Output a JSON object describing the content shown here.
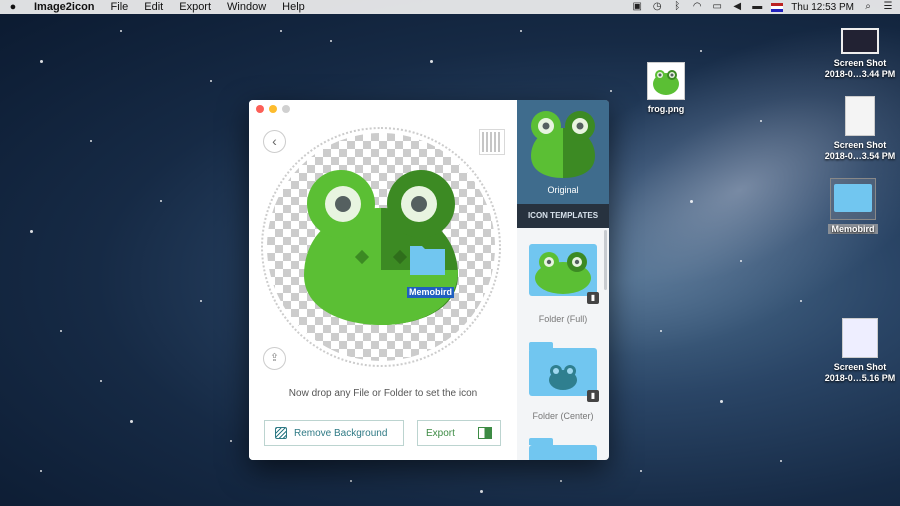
{
  "menubar": {
    "apple_icon": "apple-icon",
    "app_name": "Image2icon",
    "menus": [
      "File",
      "Edit",
      "Export",
      "Window",
      "Help"
    ],
    "clock": "Thu 12:53 PM",
    "status_icons": [
      "notification-icon",
      "time-machine-icon",
      "bluetooth-icon",
      "wifi-icon",
      "airplay-icon",
      "volume-icon",
      "battery-icon",
      "flag-icon",
      "search-icon",
      "list-icon"
    ]
  },
  "desktop": {
    "icons": [
      {
        "label": "Screen Shot\n2018-0…3.44 PM"
      },
      {
        "label": "frog.png"
      },
      {
        "label": "Screen Shot\n2018-0…3.54 PM"
      },
      {
        "label": "Memobird"
      },
      {
        "label": "Screen Shot\n2018-0…5.16 PM"
      }
    ]
  },
  "window": {
    "traffic_lights": [
      "#fc5f57",
      "#fdbc2e",
      "#d0d0d0"
    ],
    "drop_message": "Now drop any File or Folder to set the icon",
    "preview_badge": "Memobird",
    "remove_bg_label": "Remove Background",
    "export_label": "Export",
    "sidebar": {
      "original_label": "Original",
      "templates_header": "ICON TEMPLATES",
      "templates": [
        {
          "label": "Folder (Full)",
          "locked": true
        },
        {
          "label": "Folder (Center)",
          "locked": true
        }
      ]
    }
  },
  "colors": {
    "frog_light": "#5bbf34",
    "frog_dark": "#3c8a23",
    "eye_white": "#e8f4e0",
    "pupil": "#556060",
    "folder_blue": "#71c6f0",
    "sidebar_dark": "#2e3a48",
    "original_bg": "#3f6c8d"
  }
}
